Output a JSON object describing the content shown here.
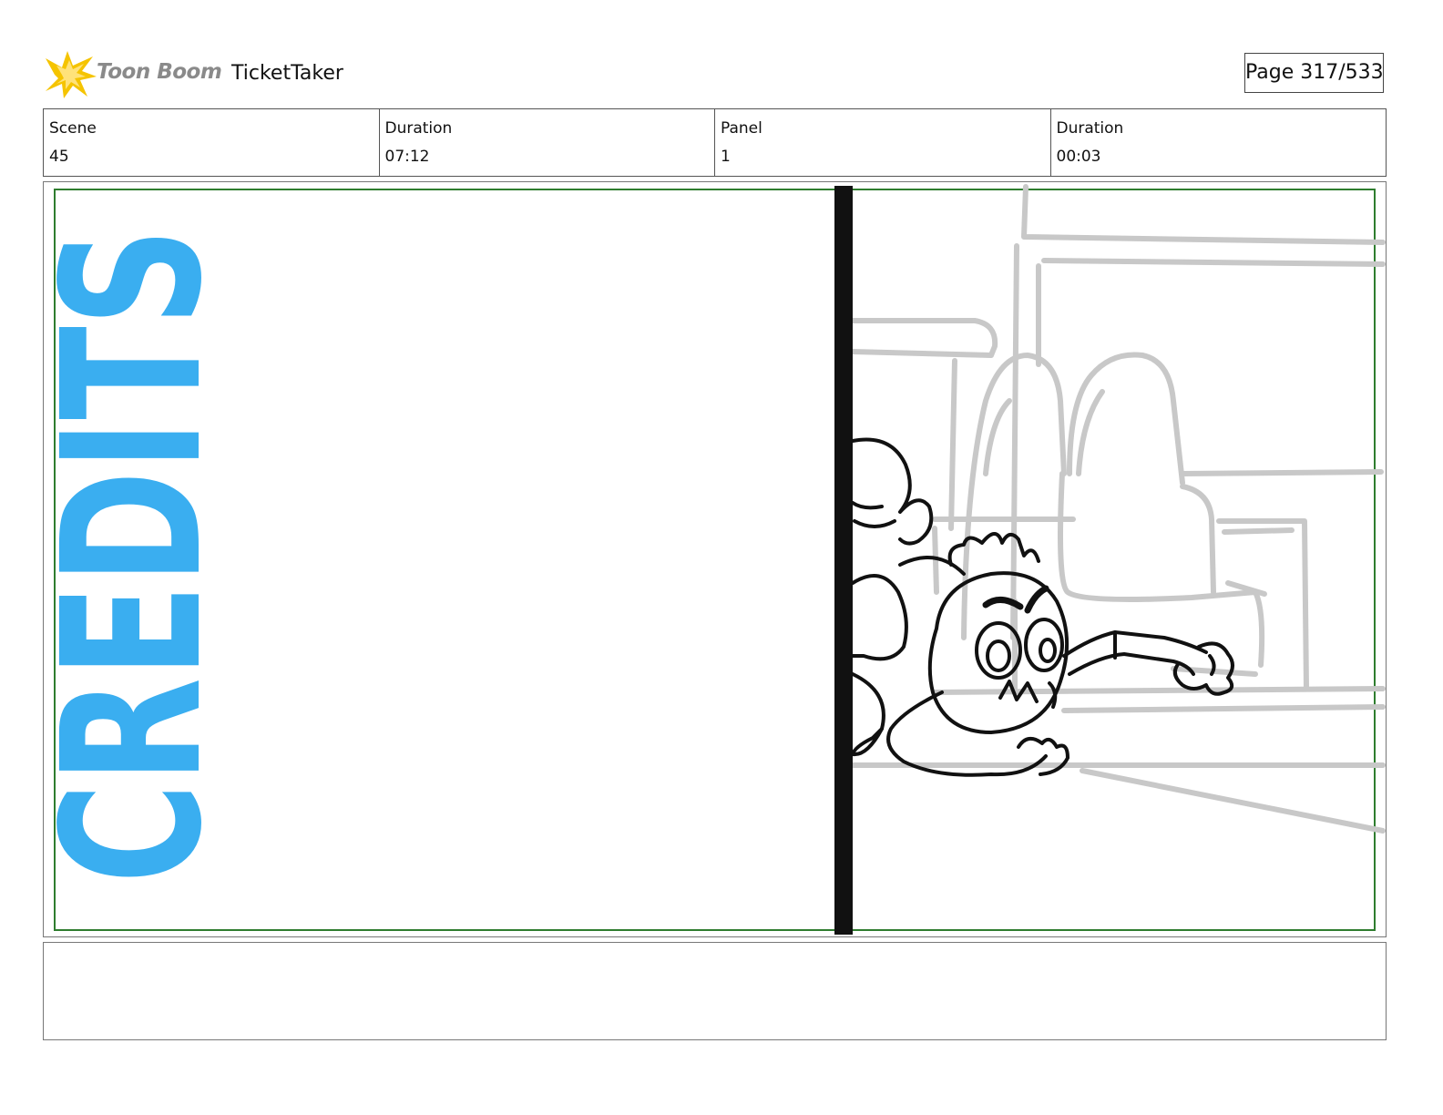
{
  "header": {
    "brand_name": "Toon Boom",
    "project_title": "TicketTaker",
    "page_indicator": "Page 317/533"
  },
  "info": {
    "scene_label": "Scene",
    "scene_value": "45",
    "scene_duration_label": "Duration",
    "scene_duration_value": "07:12",
    "panel_label": "Panel",
    "panel_value": "1",
    "panel_duration_label": "Duration",
    "panel_duration_value": "00:03"
  },
  "panel": {
    "credits_text": "CREDITS",
    "credits_color": "#3aaef0",
    "safe_frame_color": "#2f7d2f",
    "sketch_line_color": "#111111",
    "background_line_color": "#c8c8c8"
  },
  "notes": {
    "text": ""
  },
  "colors": {
    "logo_star": "#f5c400",
    "logo_word": "#8a8a8a"
  }
}
